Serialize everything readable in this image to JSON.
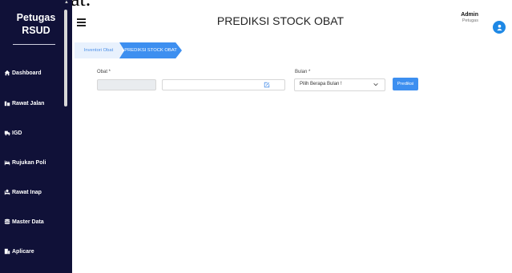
{
  "window": {
    "top_fragment": "obat."
  },
  "sidebar": {
    "brand_line1": "Petugas",
    "brand_line2": "RSUD",
    "items": [
      {
        "label": "Dashboard",
        "icon": "home-icon"
      },
      {
        "label": "Rawat Jalan",
        "icon": "clinic-icon"
      },
      {
        "label": "IGD",
        "icon": "ambulance-icon"
      },
      {
        "label": "Rujukan Poli",
        "icon": "bed-icon"
      },
      {
        "label": "Rawat Inap",
        "icon": "hospital-bed-icon"
      },
      {
        "label": "Master Data",
        "icon": "database-icon"
      },
      {
        "label": "Aplicare",
        "icon": "building-icon"
      }
    ]
  },
  "header": {
    "title": "PREDIKSI STOCK OBAT",
    "user_name": "Admin",
    "user_role": "Petugas"
  },
  "breadcrumb": [
    "Inventori Obat",
    "PREDIKSI STOCK OBAT"
  ],
  "form": {
    "obat_label": "Obat *",
    "obat_code_value": "",
    "obat_name_value": "",
    "bulan_label": "Bulan *",
    "bulan_selected": "Pilih Berapa Bulan !",
    "submit_label": "Prediksi"
  },
  "colors": {
    "sidebar": "#101138",
    "accent": "#3d8ff0",
    "avatar": "#1e88e5"
  }
}
